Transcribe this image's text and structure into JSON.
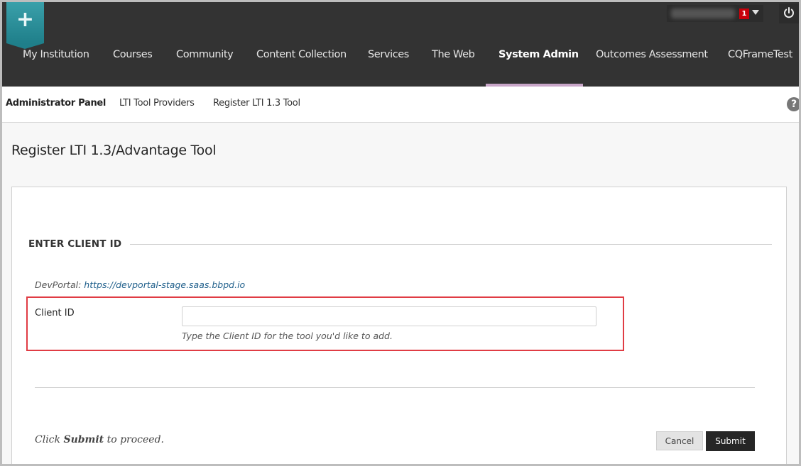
{
  "header": {
    "logo_icon": "plus-icon",
    "notification_count": "1",
    "power_icon": "power-icon",
    "nav": [
      {
        "label": "My Institution"
      },
      {
        "label": "Courses"
      },
      {
        "label": "Community"
      },
      {
        "label": "Content Collection"
      },
      {
        "label": "Services"
      },
      {
        "label": "The Web"
      },
      {
        "label": "System Admin",
        "active": true
      },
      {
        "label": "Outcomes Assessment"
      },
      {
        "label": "CQFrameTest"
      }
    ]
  },
  "breadcrumb": {
    "items": [
      "Administrator Panel",
      "LTI Tool Providers",
      "Register LTI 1.3 Tool"
    ],
    "help_label": "?"
  },
  "page": {
    "title": "Register LTI 1.3/Advantage Tool"
  },
  "form": {
    "step_title": "ENTER CLIENT ID",
    "devportal_label": "DevPortal:",
    "devportal_link": "https://devportal-stage.saas.bbpd.io",
    "client_id_label": "Client ID",
    "client_id_value": "",
    "client_id_help": "Type the Client ID for the tool you'd like to add.",
    "proceed_prefix": "Click",
    "proceed_bold": "Submit",
    "proceed_suffix": "to proceed.",
    "cancel_label": "Cancel",
    "submit_label": "Submit"
  },
  "colors": {
    "topbar": "#333333",
    "logo": "#2a8f99",
    "active_underline": "#c9a6c9",
    "highlight": "#e03c44",
    "badge": "#c8000a"
  }
}
